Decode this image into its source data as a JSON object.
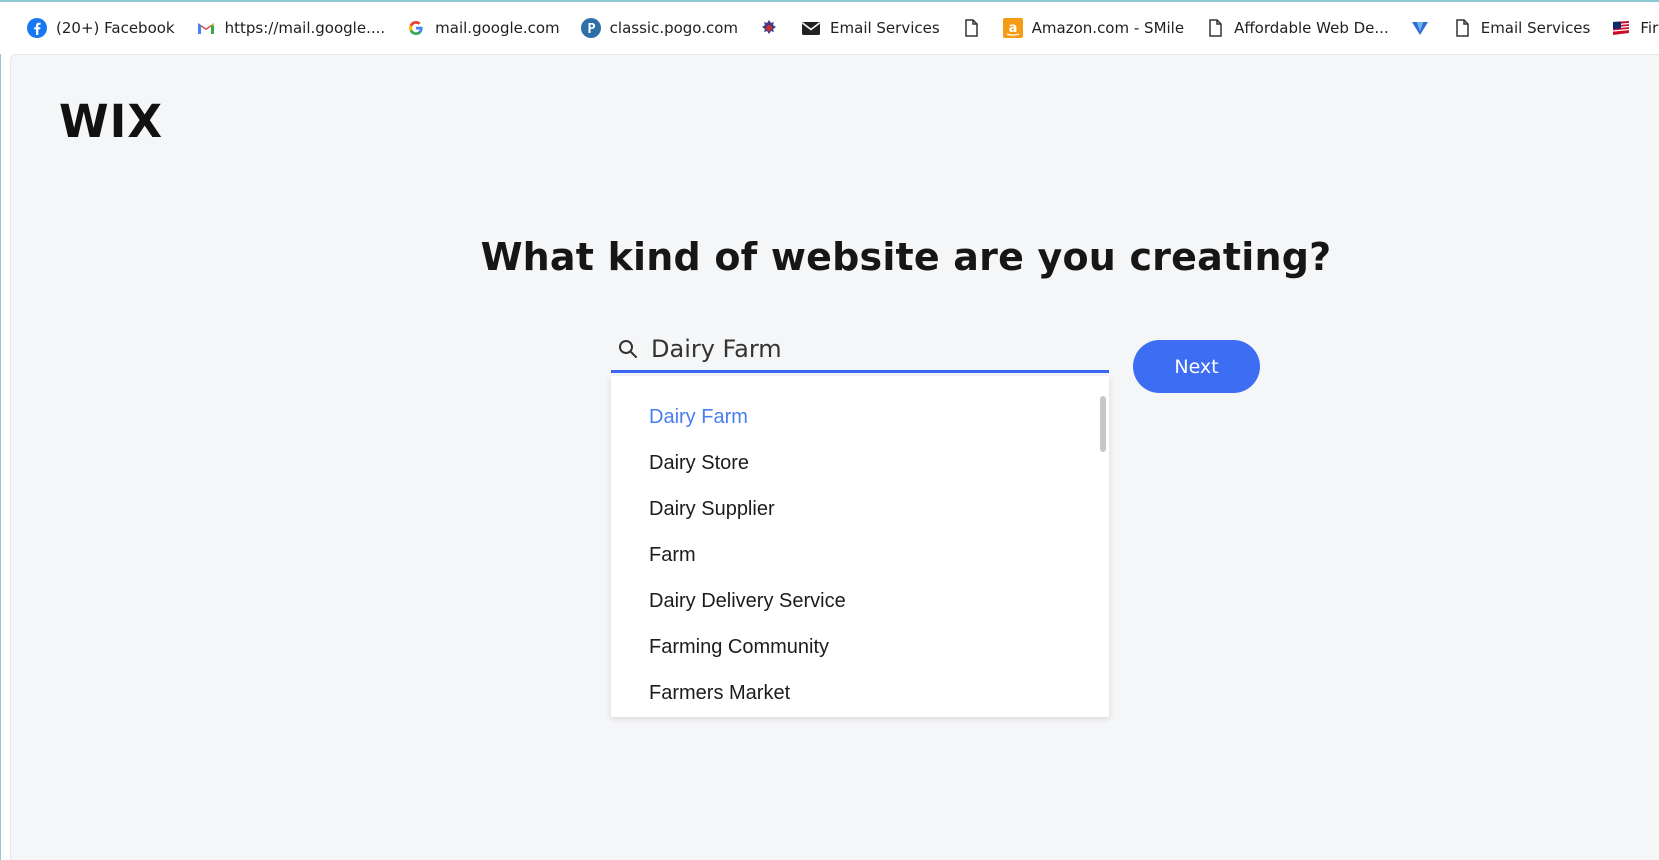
{
  "bookmarks": [
    {
      "label": "(20+) Facebook",
      "icon": "facebook-icon"
    },
    {
      "label": "https://mail.google....",
      "icon": "gmail-icon"
    },
    {
      "label": "mail.google.com",
      "icon": "google-icon"
    },
    {
      "label": "classic.pogo.com",
      "icon": "pogo-icon"
    },
    {
      "label": "",
      "icon": "crest-icon"
    },
    {
      "label": "Email Services",
      "icon": "envelope-icon"
    },
    {
      "label": "",
      "icon": "document-icon"
    },
    {
      "label": "Amazon.com - SMile",
      "icon": "amazon-icon"
    },
    {
      "label": "Affordable Web De...",
      "icon": "document-icon"
    },
    {
      "label": "",
      "icon": "v-logo-icon"
    },
    {
      "label": "Email Services",
      "icon": "document-icon"
    },
    {
      "label": "First Citizens Bank -...",
      "icon": "flag-icon"
    }
  ],
  "logo": "WIX",
  "heading": "What kind of website are you creating?",
  "search": {
    "value": "Dairy Farm",
    "icon": "search-icon"
  },
  "next_label": "Next",
  "suggestions": [
    "Dairy Farm",
    "Dairy Store",
    "Dairy Supplier",
    "Farm",
    "Dairy Delivery Service",
    "Farming Community",
    "Farmers Market"
  ],
  "colors": {
    "accent": "#3c6df2",
    "highlight": "#4a7df2",
    "background": "#f5f6f8"
  }
}
